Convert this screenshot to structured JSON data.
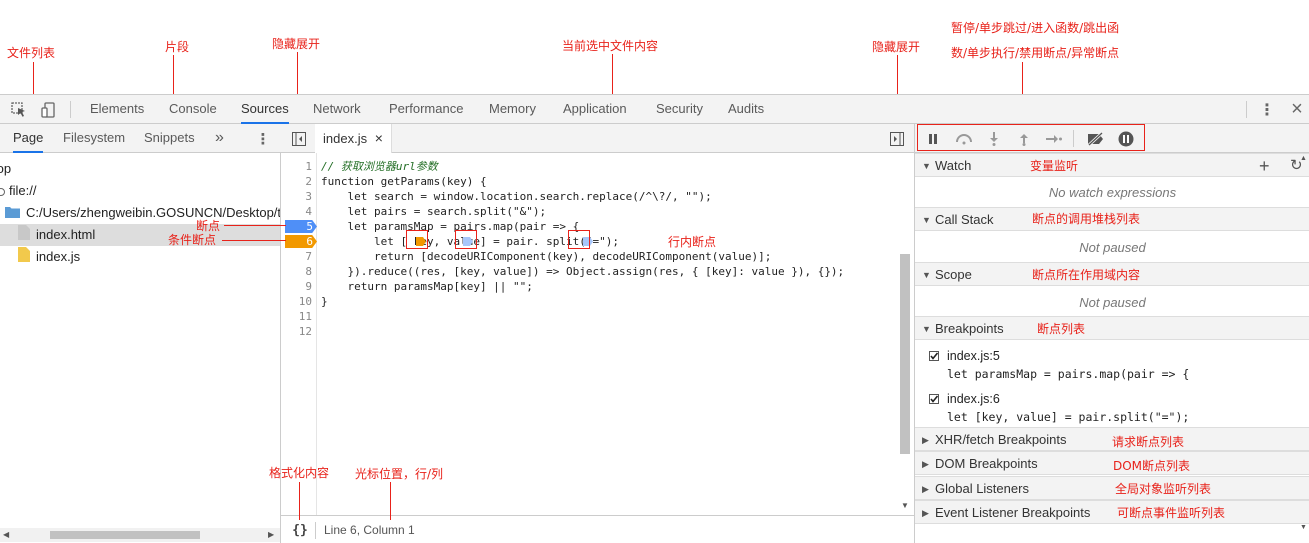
{
  "devtools": {
    "tabs": [
      "Elements",
      "Console",
      "Sources",
      "Network",
      "Performance",
      "Memory",
      "Application",
      "Security",
      "Audits"
    ],
    "active_tab": "Sources"
  },
  "navigator": {
    "tabs": [
      "Page",
      "Filesystem",
      "Snippets"
    ],
    "more": "»",
    "tree": [
      "top",
      "file://",
      "C:/Users/zhengweibin.GOSUNCN/Desktop/t",
      "index.html",
      "index.js"
    ]
  },
  "editor": {
    "file_tab": "index.js",
    "close": "×",
    "line_numbers": [
      "1",
      "2",
      "3",
      "4",
      "5",
      "6",
      "7",
      "8",
      "9",
      "10",
      "11",
      "12"
    ],
    "lines": [
      "// 获取浏览器url参数",
      "function getParams(key) {",
      "    let search = window.location.search.replace(/^\\?/, \"\");",
      "    let pairs = search.split(\"&\");",
      "    let paramsMap = pairs.map(pair => {",
      "        let [ key, value] = pair. split(\"=\");",
      "        return [decodeURIComponent(key), decodeURIComponent(value)];",
      "    }).reduce((res, [key, value]) => Object.assign(res, { [key]: value }), {});",
      "    return paramsMap[key] || \"\";",
      "}",
      "",
      ""
    ],
    "format_button": "{}",
    "cursor": "Line 6, Column 1"
  },
  "sidebar": {
    "sections": {
      "watch": "Watch",
      "watch_empty": "No watch expressions",
      "call_stack": "Call Stack",
      "call_stack_empty": "Not paused",
      "scope": "Scope",
      "scope_empty": "Not paused",
      "breakpoints": "Breakpoints",
      "xhr": "XHR/fetch Breakpoints",
      "dom": "DOM Breakpoints",
      "global": "Global Listeners",
      "event": "Event Listener Breakpoints"
    },
    "breakpoints": [
      {
        "location": "index.js:5",
        "code": "let paramsMap = pairs.map(pair => {"
      },
      {
        "location": "index.js:6",
        "code": "let [key, value] = pair.split(\"=\");"
      }
    ]
  },
  "annotations": {
    "file_list": "文件列表",
    "snippets": "片段",
    "hide_expand_left": "隐藏展开",
    "current_file": "当前选中文件内容",
    "hide_expand_right": "隐藏展开",
    "debug_controls_1": "暂停/单步跳过/进入函数/跳出函",
    "debug_controls_2": "数/单步执行/禁用断点/异常断点",
    "breakpoint": "断点",
    "conditional_breakpoint": "条件断点",
    "inline_breakpoint": "行内断点",
    "format": "格式化内容",
    "cursor_pos": "光标位置，行/列",
    "watch": "变量监听",
    "call_stack": "断点的调用堆栈列表",
    "scope": "断点所在作用域内容",
    "breakpoints": "断点列表",
    "xhr": "请求断点列表",
    "dom": "DOM断点列表",
    "global": "全局对象监听列表",
    "event": "可断点事件监听列表"
  },
  "colors": {
    "accent": "#1a73e8",
    "annotation": "#e8221a",
    "breakpoint": "#4f8ff7",
    "conditional_breakpoint": "#f29900"
  }
}
